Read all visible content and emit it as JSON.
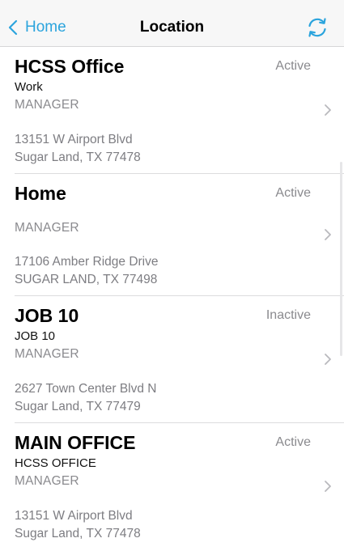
{
  "nav": {
    "back_label": "Home",
    "title": "Location",
    "back_icon": "chevron-left-icon",
    "refresh_icon": "refresh-icon",
    "accent_color": "#2BA4DD"
  },
  "locations": [
    {
      "name": "HCSS Office",
      "status": "Active",
      "type": "Work",
      "role": "MANAGER",
      "address_line1": "13151 W Airport Blvd",
      "address_line2": "Sugar Land, TX 77478"
    },
    {
      "name": "Home",
      "status": "Active",
      "type": "",
      "role": "MANAGER",
      "address_line1": "17106 Amber Ridge Drive",
      "address_line2": "SUGAR LAND, TX 77498"
    },
    {
      "name": "JOB 10",
      "status": "Inactive",
      "type": "JOB 10",
      "role": "MANAGER",
      "address_line1": "2627 Town Center Blvd N",
      "address_line2": "Sugar Land, TX 77479"
    },
    {
      "name": "MAIN OFFICE",
      "status": "Active",
      "type": "HCSS OFFICE",
      "role": "MANAGER",
      "address_line1": "13151 W Airport Blvd",
      "address_line2": "Sugar Land, TX 77478"
    }
  ]
}
